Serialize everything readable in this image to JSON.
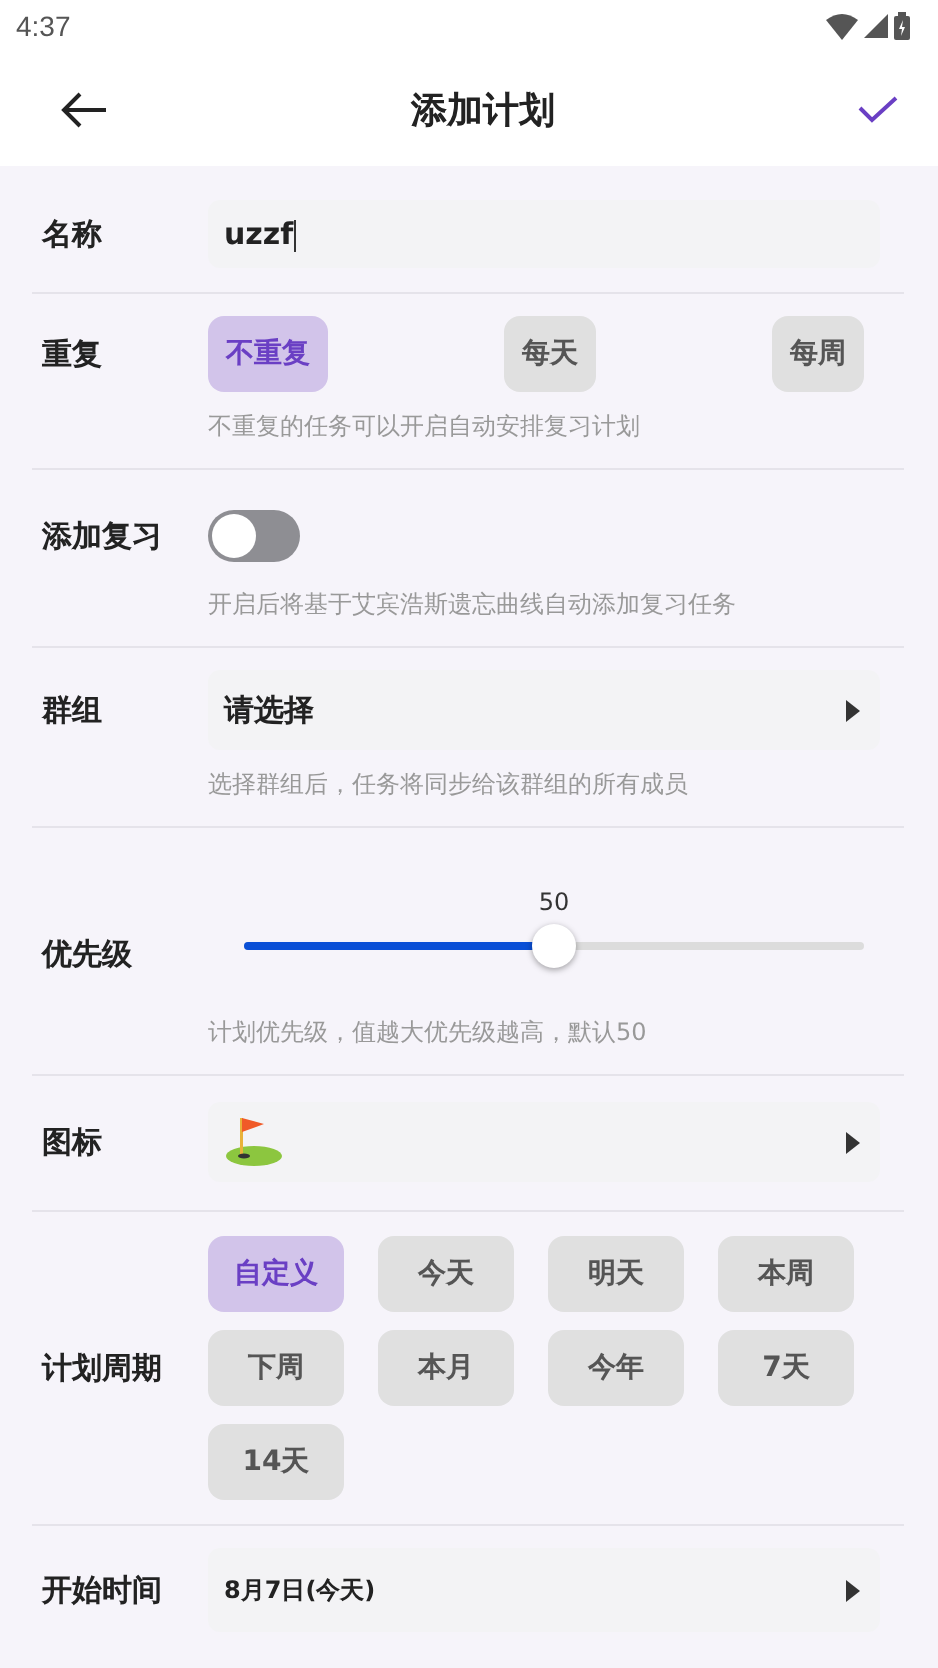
{
  "status_bar": {
    "time": "4:37"
  },
  "app_bar": {
    "title": "添加计划"
  },
  "rows": [
    {
      "kind": "text",
      "label": "名称",
      "value": "uzzf"
    },
    {
      "kind": "choices",
      "label": "重复",
      "options": [
        {
          "label": "不重复",
          "selected": true
        },
        {
          "label": "每天",
          "selected": false
        },
        {
          "label": "每周",
          "selected": false
        }
      ],
      "hint": "不重复的任务可以开启自动安排复习计划"
    },
    {
      "kind": "toggle",
      "label": "添加复习",
      "on": false,
      "hint": "开启后将基于艾宾浩斯遗忘曲线自动添加复习任务"
    },
    {
      "kind": "select",
      "label": "群组",
      "value": "请选择",
      "hint": "选择群组后，任务将同步给该群组的所有成员"
    },
    {
      "kind": "slider",
      "label": "优先级",
      "reading": "50",
      "level": 0.5,
      "hint": "计划优先级，值越大优先级越高，默认50"
    },
    {
      "kind": "icon_select",
      "label": "图标"
    },
    {
      "kind": "grid",
      "label": "计划周期",
      "options": [
        {
          "label": "自定义",
          "selected": true
        },
        {
          "label": "今天",
          "selected": false
        },
        {
          "label": "明天",
          "selected": false
        },
        {
          "label": "本周",
          "selected": false
        },
        {
          "label": "下周",
          "selected": false
        },
        {
          "label": "本月",
          "selected": false
        },
        {
          "label": "今年",
          "selected": false
        },
        {
          "label": "7天",
          "selected": false
        },
        {
          "label": "14天",
          "selected": false
        }
      ]
    },
    {
      "kind": "date_select",
      "label": "开始时间",
      "value": "8月7日(今天)"
    }
  ]
}
